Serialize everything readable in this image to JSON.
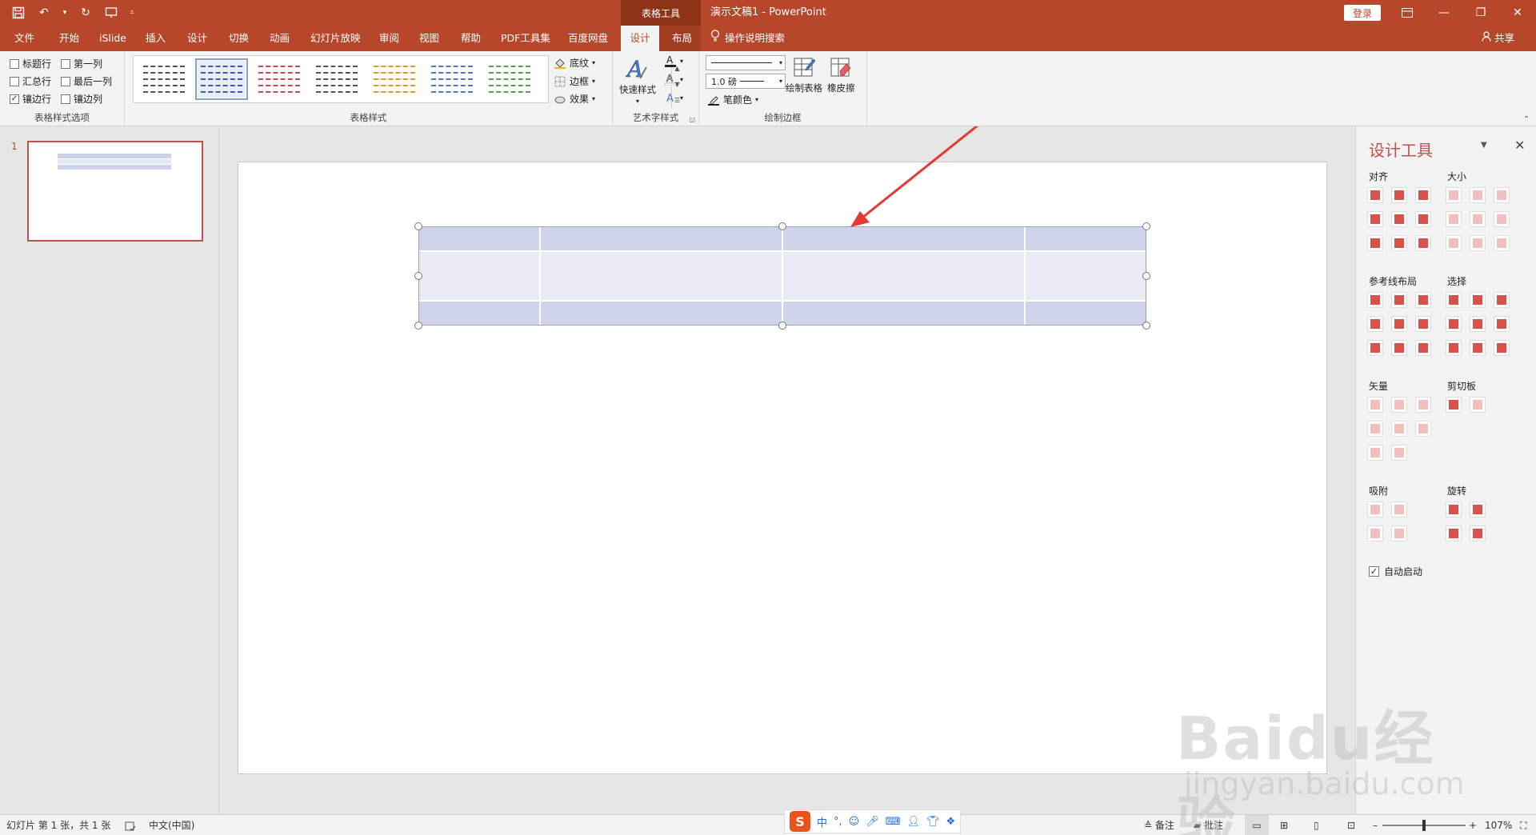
{
  "titlebar": {
    "context_group": "表格工具",
    "document_title": "演示文稿1  -  PowerPoint",
    "login": "登录"
  },
  "tabs": [
    {
      "label": "文件"
    },
    {
      "label": "开始"
    },
    {
      "label": "iSlide"
    },
    {
      "label": "插入"
    },
    {
      "label": "设计"
    },
    {
      "label": "切换"
    },
    {
      "label": "动画"
    },
    {
      "label": "幻灯片放映"
    },
    {
      "label": "审阅"
    },
    {
      "label": "视图"
    },
    {
      "label": "帮助"
    },
    {
      "label": "PDF工具集"
    },
    {
      "label": "百度网盘"
    },
    {
      "label": "设计",
      "active": true
    },
    {
      "label": "布局"
    }
  ],
  "tell_me": "操作说明搜索",
  "share": "共享",
  "ribbon": {
    "options": {
      "label": "表格样式选项",
      "items": [
        {
          "label": "标题行",
          "checked": false
        },
        {
          "label": "第一列",
          "checked": false
        },
        {
          "label": "汇总行",
          "checked": false
        },
        {
          "label": "最后一列",
          "checked": false
        },
        {
          "label": "镶边行",
          "checked": true
        },
        {
          "label": "镶边列",
          "checked": false
        }
      ]
    },
    "styles": {
      "label": "表格样式",
      "thumb_colors": [
        "#555555",
        "#3b5bab",
        "#c0504d",
        "#555555",
        "#e19b2b",
        "#4f79bd",
        "#5aa150"
      ],
      "shading": "底纹",
      "borders": "边框",
      "effects": "效果"
    },
    "wordart": {
      "label": "艺术字样式",
      "quick_styles": "快速样式"
    },
    "draw_borders": {
      "label": "绘制边框",
      "pen_weight": "1.0 磅",
      "pen_color": "笔颜色",
      "draw_table": "绘制表格",
      "eraser": "橡皮擦"
    }
  },
  "thumbnail": {
    "number": "1"
  },
  "design_pane": {
    "title": "设计工具",
    "sections": {
      "align": "对齐",
      "size": "大小",
      "guides": "参考线布局",
      "select": "选择",
      "vector": "矢量",
      "clipboard": "剪切板",
      "snap": "吸附",
      "rotate": "旋转"
    },
    "auto_start": "自动启动",
    "auto_start_checked": true
  },
  "statusbar": {
    "slide_info": "幻灯片 第 1 张，共 1 张",
    "language": "中文(中国)",
    "notes": "备注",
    "comments": "批注",
    "zoom": "107%"
  },
  "ime": {
    "logo": "S",
    "mode": "中"
  },
  "watermark": {
    "logo": "Baidu经验",
    "url": "jingyan.baidu.com"
  },
  "accent_color": "#b7472a"
}
